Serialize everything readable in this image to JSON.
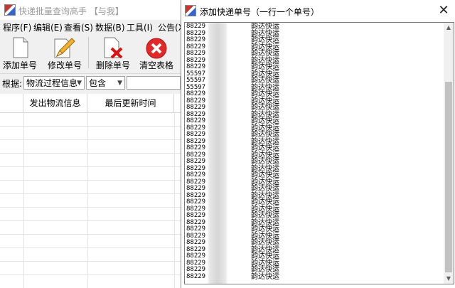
{
  "main": {
    "title": "快递批量查询高手 【与我】",
    "menu": [
      "程序(F)",
      "编辑(E)",
      "查看(S)",
      "数据(B)",
      "工具(I)",
      "公告(X"
    ],
    "toolbar": {
      "add": "添加单号",
      "edit": "修改单号",
      "delete": "删除单号",
      "clear": "清空表格"
    },
    "filter": {
      "label": "根据:",
      "field": "物流过程信息",
      "op": "包含",
      "value": ""
    },
    "grid": {
      "columns": [
        "发出物流信息",
        "最后更新时间"
      ]
    }
  },
  "dialog": {
    "title": "添加快递单号（一行一个单号）",
    "close": "✕",
    "lines": [
      {
        "num": "88229",
        "courier": "韵达快运"
      },
      {
        "num": "88229",
        "courier": "韵达快运"
      },
      {
        "num": "88229",
        "courier": "韵达快运"
      },
      {
        "num": "88229",
        "courier": "韵达快运"
      },
      {
        "num": "88229",
        "courier": "韵达快运"
      },
      {
        "num": "88229",
        "courier": "韵达快运"
      },
      {
        "num": "88229",
        "courier": "韵达快运"
      },
      {
        "num": "55597",
        "courier": "韵达快运"
      },
      {
        "num": "55597",
        "courier": "韵达快运"
      },
      {
        "num": "55597",
        "courier": "韵达快运"
      },
      {
        "num": "88229",
        "courier": "韵达快运"
      },
      {
        "num": "88229",
        "courier": "韵达快运"
      },
      {
        "num": "88229",
        "courier": "韵达快运"
      },
      {
        "num": "88229",
        "courier": "韵达快运"
      },
      {
        "num": "88229",
        "courier": "韵达快运"
      },
      {
        "num": "88229",
        "courier": "韵达快运"
      },
      {
        "num": "88229",
        "courier": "韵达快运"
      },
      {
        "num": "88229",
        "courier": "韵达快运"
      },
      {
        "num": "88229",
        "courier": "韵达快运"
      },
      {
        "num": "88229",
        "courier": "韵达快运"
      },
      {
        "num": "88229",
        "courier": "韵达快运"
      },
      {
        "num": "88229",
        "courier": "韵达快运"
      },
      {
        "num": "88229",
        "courier": "韵达快运"
      },
      {
        "num": "88229",
        "courier": "韵达快运"
      },
      {
        "num": "88229",
        "courier": "韵达快运"
      },
      {
        "num": "88229",
        "courier": "韵达快运"
      },
      {
        "num": "88229",
        "courier": "韵达快运"
      },
      {
        "num": "88229",
        "courier": "韵达快运"
      },
      {
        "num": "88229",
        "courier": "韵达快运"
      },
      {
        "num": "88229",
        "courier": "韵达快运"
      },
      {
        "num": "88229",
        "courier": "韵达快运"
      },
      {
        "num": "88229",
        "courier": "韵达快运"
      },
      {
        "num": "88229",
        "courier": "韵达快运"
      },
      {
        "num": "88229",
        "courier": "韵达快运"
      },
      {
        "num": "88229",
        "courier": "韵达快运"
      },
      {
        "num": "88229",
        "courier": "韵达快运"
      },
      {
        "num": "88229",
        "courier": "韵达快运"
      },
      {
        "num": "88229",
        "courier": "韵达快运"
      }
    ]
  }
}
